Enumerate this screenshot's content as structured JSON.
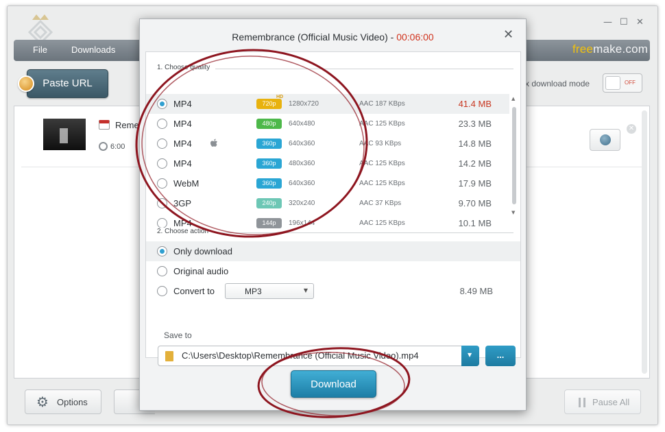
{
  "main": {
    "menu": [
      "File",
      "Downloads"
    ],
    "brand_a": "free",
    "brand_b": "make.com",
    "paste_url": "Paste URL",
    "mode_text": "x download mode",
    "toggle_text": "OFF",
    "item_title": "Reme",
    "item_duration": "6:00",
    "options": "Options",
    "pause_all": "Pause All",
    "win_min": "—",
    "win_max": "☐",
    "win_close": "✕"
  },
  "dialog": {
    "title": "Remembrance (Official Music Video) - ",
    "duration": "00:06:00",
    "close": "✕",
    "section_quality": "1. Choose quality",
    "section_action": "2. Choose action",
    "quality_rows": [
      {
        "format": "MP4",
        "badge": "720p",
        "hd": "HD",
        "badge_color": "#e8b20e",
        "res": "1280x720",
        "audio": "AAC 187  KBps",
        "size": "41.4 MB",
        "selected": true
      },
      {
        "format": "MP4",
        "badge": "480p",
        "badge_color": "#4db84a",
        "res": "640x480",
        "audio": "AAC 125  KBps",
        "size": "23.3 MB"
      },
      {
        "format": "MP4",
        "badge": "360p",
        "badge_color": "#2aa6d4",
        "res": "640x360",
        "audio": "AAC 93  KBps",
        "size": "14.8 MB",
        "apple": true
      },
      {
        "format": "MP4",
        "badge": "360p",
        "badge_color": "#2aa6d4",
        "res": "480x360",
        "audio": "AAC 125  KBps",
        "size": "14.2 MB"
      },
      {
        "format": "WebM",
        "badge": "360p",
        "badge_color": "#2aa6d4",
        "res": "640x360",
        "audio": "AAC 125  KBps",
        "size": "17.9 MB"
      },
      {
        "format": "3GP",
        "badge": "240p",
        "badge_color": "#6dc7b5",
        "res": "320x240",
        "audio": "AAC 37  KBps",
        "size": "9.70 MB"
      },
      {
        "format": "MP4",
        "badge": "144p",
        "badge_color": "#8f9499",
        "res": "196x144",
        "audio": "AAC 125  KBps",
        "size": "10.1 MB"
      }
    ],
    "actions": {
      "only_download": "Only download",
      "original_audio": "Original audio",
      "convert_to": "Convert to",
      "convert_format": "MP3",
      "convert_size": "8.49 MB"
    },
    "save_to_label": "Save to",
    "save_path": "C:\\Users\\Desktop\\Remembrance (Official Music Video).mp4",
    "browse": "...",
    "download": "Download"
  },
  "colors": {
    "accent_blue": "#2a9ccd",
    "duration_red": "#d0311b",
    "annotation_red": "#8e1620"
  }
}
